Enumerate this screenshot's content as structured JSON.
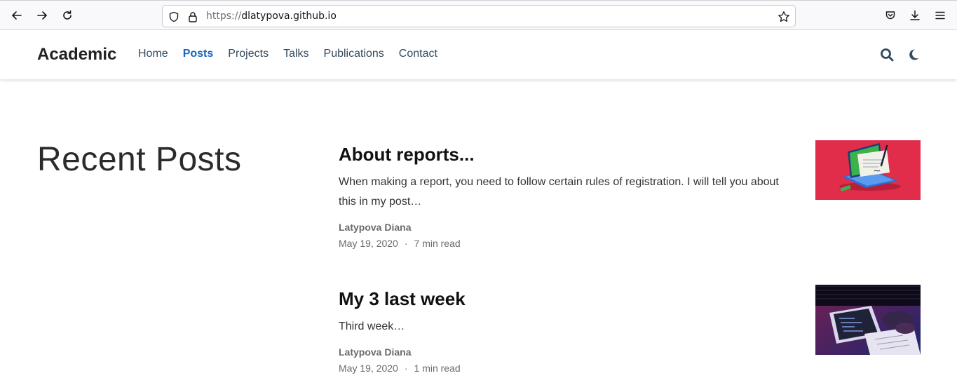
{
  "browser": {
    "url_protocol": "https://",
    "url_host": "dlatypova.github.io"
  },
  "site": {
    "brand": "Academic",
    "menu": [
      {
        "label": "Home",
        "active": false
      },
      {
        "label": "Posts",
        "active": true
      },
      {
        "label": "Projects",
        "active": false
      },
      {
        "label": "Talks",
        "active": false
      },
      {
        "label": "Publications",
        "active": false
      },
      {
        "label": "Contact",
        "active": false
      }
    ],
    "accent_color": "#1565c0"
  },
  "main": {
    "section_title": "Recent Posts",
    "posts": [
      {
        "title": "About reports...",
        "summary": "When making a report, you need to follow certain rules of registration. I will tell you about this in my post…",
        "author": "Latypova Diana",
        "date": "May 19, 2020",
        "read_time": "7 min read",
        "separator": "·",
        "thumbnail_icon": "laptop-document-illustration"
      },
      {
        "title": "My 3 last week",
        "summary": "Third week…",
        "author": "Latypova Diana",
        "date": "May 19, 2020",
        "read_time": "1 min read",
        "separator": "·",
        "thumbnail_icon": "tablet-code-photo"
      }
    ]
  }
}
